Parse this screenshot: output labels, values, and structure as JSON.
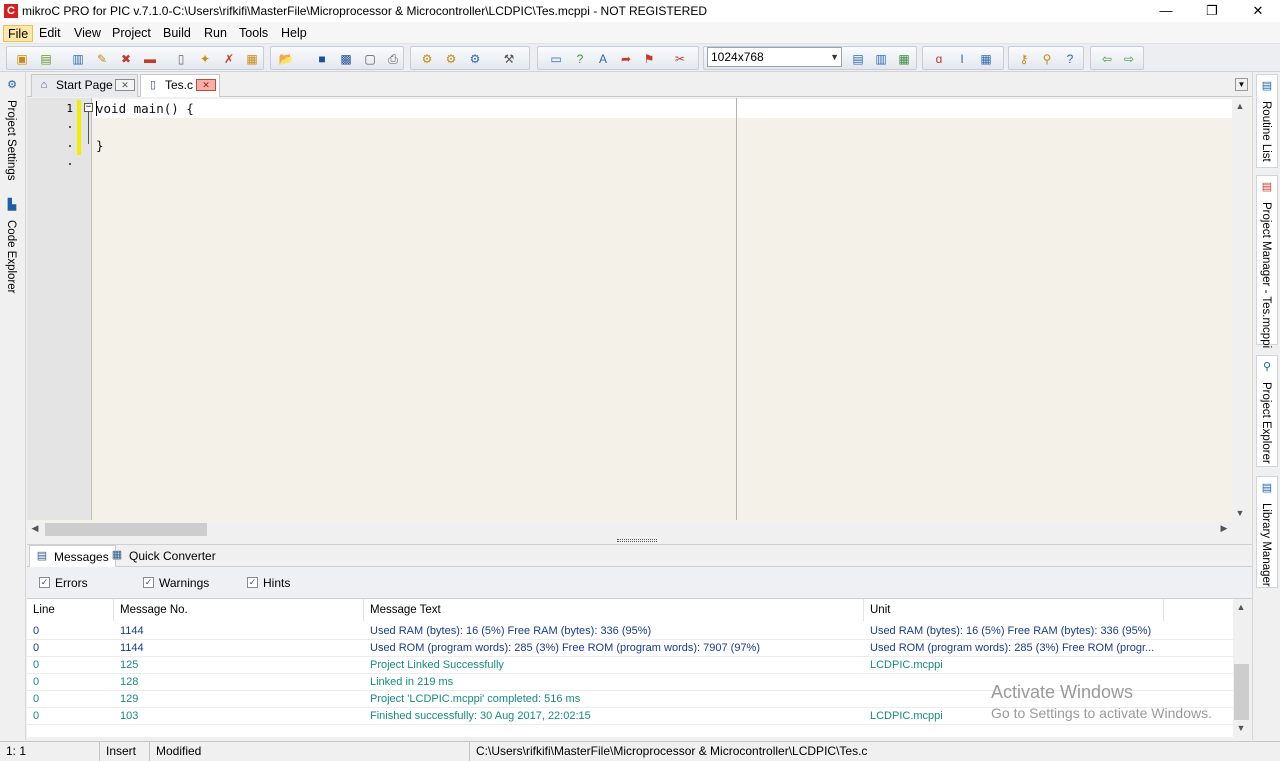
{
  "window": {
    "title": "mikroC PRO for PIC v.7.1.0-C:\\Users\\rifkifi\\MasterFile\\Microprocessor & Microcontroller\\LCDPIC\\Tes.mcppi - NOT REGISTERED",
    "app_icon_letter": "C",
    "minimize": "—",
    "maximize": "❐",
    "close": "✕"
  },
  "menu": [
    "File",
    "Edit",
    "View",
    "Project",
    "Build",
    "Run",
    "Tools",
    "Help"
  ],
  "toolbar": {
    "resolution_value": "1024x768"
  },
  "left_sidebar": {
    "tabs": [
      "Project Settings",
      "Code Explorer"
    ]
  },
  "right_sidebar": {
    "tabs": [
      "Routine List",
      "Project Manager - Tes.mcppi",
      "Project Explorer",
      "Library Manager"
    ]
  },
  "tabs": [
    {
      "label": "Start Page",
      "icon": "home-icon",
      "active": false
    },
    {
      "label": "Tes.c",
      "icon": "file-icon",
      "active": true
    }
  ],
  "editor": {
    "line_number": "1",
    "lines": [
      "void main() {",
      "",
      "}"
    ]
  },
  "messages": {
    "tabs": [
      "Messages",
      "Quick Converter"
    ],
    "filters": [
      {
        "label": "Errors",
        "checked": true
      },
      {
        "label": "Warnings",
        "checked": true
      },
      {
        "label": "Hints",
        "checked": true
      }
    ],
    "columns": [
      "Line",
      "Message No.",
      "Message Text",
      "Unit"
    ],
    "rows": [
      {
        "line": "0",
        "no": "1144",
        "text": "Used RAM (bytes): 16 (5%)  Free RAM (bytes): 336 (95%)",
        "unit": "Used RAM (bytes): 16 (5%)  Free RAM (bytes): 336 (95%)",
        "color": "#1a3c8c"
      },
      {
        "line": "0",
        "no": "1144",
        "text": "Used ROM (program words): 285 (3%)  Free ROM (program words): 7907 (97%)",
        "unit": "Used ROM (program words): 285 (3%)  Free ROM (progr...",
        "color": "#1a3c8c"
      },
      {
        "line": "0",
        "no": "125",
        "text": "Project Linked Successfully",
        "unit": "LCDPIC.mcppi",
        "color": "#178a7e"
      },
      {
        "line": "0",
        "no": "128",
        "text": "Linked in 219 ms",
        "unit": "",
        "color": "#178a7e"
      },
      {
        "line": "0",
        "no": "129",
        "text": "Project 'LCDPIC.mcppi' completed: 516 ms",
        "unit": "",
        "color": "#178a7e"
      },
      {
        "line": "0",
        "no": "103",
        "text": "Finished successfully: 30 Aug 2017, 22:02:15",
        "unit": "LCDPIC.mcppi",
        "color": "#178a7e"
      }
    ]
  },
  "watermark": {
    "line1": "Activate Windows",
    "line2": "Go to Settings to activate Windows."
  },
  "status": {
    "position": "1: 1",
    "mode": "Insert",
    "state": "Modified",
    "path": "C:\\Users\\rifkifi\\MasterFile\\Microprocessor & Microcontroller\\LCDPIC\\Tes.c"
  }
}
